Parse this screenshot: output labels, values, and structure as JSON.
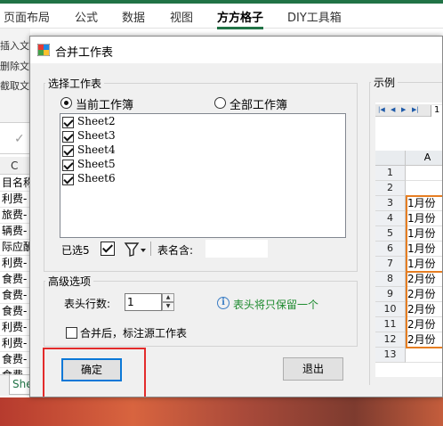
{
  "ribbon": {
    "tabs": [
      {
        "label": "页面布局",
        "active": false
      },
      {
        "label": "公式",
        "active": false
      },
      {
        "label": "数据",
        "active": false
      },
      {
        "label": "视图",
        "active": false
      },
      {
        "label": "方方格子",
        "active": true
      },
      {
        "label": "DIY工具箱",
        "active": false
      }
    ],
    "left_items": [
      "插入文",
      "删除文",
      "截取文"
    ]
  },
  "sheet_bg": {
    "col_header": "C",
    "cells": [
      "目名称",
      "利费-",
      "旅费-",
      "辆费-",
      "际应酬",
      "利费-",
      "食费-",
      "食费-",
      "食费-",
      "利费-",
      "利费-",
      "食费-",
      "食费-"
    ],
    "sheet_tab_label": "She"
  },
  "dialog": {
    "title": "合并工作表",
    "select_group": {
      "label": "选择工作表",
      "radio_current": "当前工作簿",
      "radio_all": "全部工作簿",
      "sheets": [
        {
          "name": "Sheet2",
          "checked": true
        },
        {
          "name": "Sheet3",
          "checked": true
        },
        {
          "name": "Sheet4",
          "checked": true
        },
        {
          "name": "Sheet5",
          "checked": true
        },
        {
          "name": "Sheet6",
          "checked": true
        }
      ],
      "selected_count": "已选5",
      "sheetname_label": "表名含:",
      "sheetname_value": ""
    },
    "advanced": {
      "label": "高级选项",
      "header_rows_label": "表头行数:",
      "header_rows_value": "1",
      "info_text": "表头将只保留一个",
      "mark_source_label": "合并后，标注源工作表",
      "mark_source_checked": false
    },
    "buttons": {
      "ok": "确定",
      "cancel": "退出"
    },
    "preview": {
      "label": "示例",
      "sheet_tab": "1",
      "col_header": "A",
      "rows": [
        {
          "num": "1",
          "value": ""
        },
        {
          "num": "2",
          "value": ""
        },
        {
          "num": "3",
          "value": "1月份"
        },
        {
          "num": "4",
          "value": "1月份"
        },
        {
          "num": "5",
          "value": "1月份"
        },
        {
          "num": "6",
          "value": "1月份"
        },
        {
          "num": "7",
          "value": "1月份"
        },
        {
          "num": "8",
          "value": "2月份"
        },
        {
          "num": "9",
          "value": "2月份"
        },
        {
          "num": "10",
          "value": "2月份"
        },
        {
          "num": "11",
          "value": "2月份"
        },
        {
          "num": "12",
          "value": "2月份"
        },
        {
          "num": "13",
          "value": ""
        }
      ]
    }
  },
  "colors": {
    "excel_green": "#217346",
    "highlight_red": "#e32b2b",
    "group_orange": "#e67e22",
    "info_green": "#1d8a2e",
    "focus_blue": "#0b78d7"
  }
}
